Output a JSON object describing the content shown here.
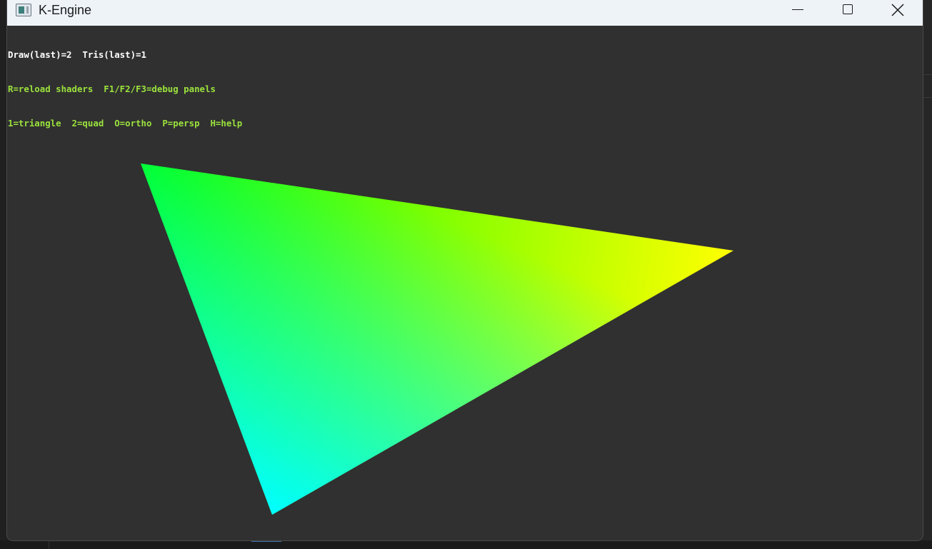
{
  "window": {
    "title": "K-Engine",
    "controls": {
      "minimize_icon": "minimize-icon",
      "maximize_icon": "maximize-icon",
      "close_icon": "close-icon"
    }
  },
  "hud": {
    "stats": "Draw(last)=2  Tris(last)=1",
    "help_line_1": "R=reload shaders  F1/F2/F3=debug panels",
    "help_line_2": "1=triangle  2=quad  O=ortho  P=persp  H=help",
    "stats_color": "#ffffff",
    "help_color": "#9be23d"
  },
  "scene": {
    "background_color": "#303030",
    "mesh": "triangle",
    "vertex_colors": [
      "#00ff00",
      "#ffff00",
      "#00ffff"
    ]
  }
}
